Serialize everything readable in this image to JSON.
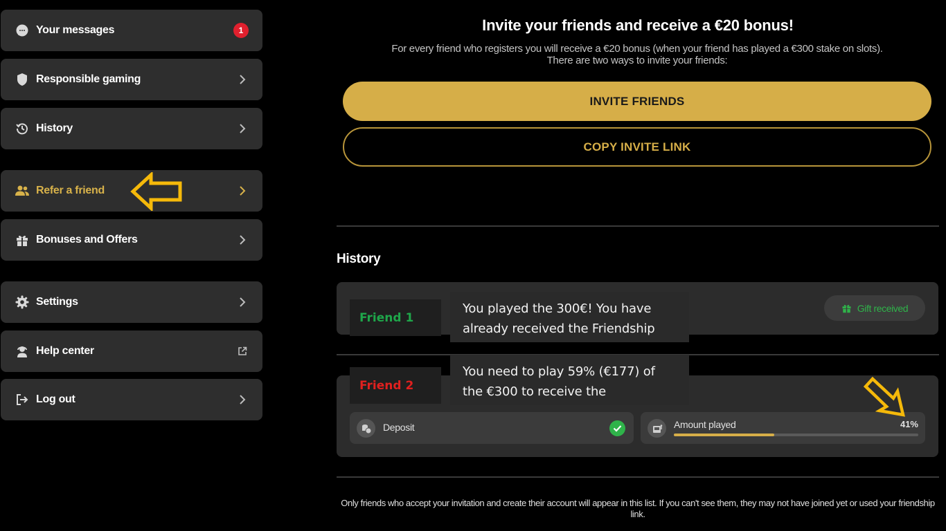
{
  "sidebar": {
    "items": [
      {
        "label": "Your messages",
        "badge": "1"
      },
      {
        "label": "Responsible gaming"
      },
      {
        "label": "History"
      },
      {
        "label": "Refer a friend"
      },
      {
        "label": "Bonuses and Offers"
      },
      {
        "label": "Settings"
      },
      {
        "label": "Help center"
      },
      {
        "label": "Log out"
      }
    ]
  },
  "main": {
    "title": "Invite your friends and receive a €20 bonus!",
    "subtitle": "For every friend who registers you will receive a €20 bonus (when your friend has played a €300 stake on slots). There are two ways to invite your friends:",
    "invite_button": "INVITE FRIENDS",
    "copy_button": "COPY INVITE LINK",
    "history_title": "History",
    "friend1": {
      "name": "Friend 1",
      "note": "You played the 300€! You have already received the Friendship",
      "status": "Gift received"
    },
    "friend2": {
      "name": "Friend 2",
      "note": "You need to play 59% (€177) of the €300 to receive the",
      "deposit_label": "Deposit",
      "amount_label": "Amount played",
      "progress_text": "41%",
      "progress": 0.41
    },
    "footer": "Only friends who accept your invitation and create their account will appear in this list. If you can't see them, they may not have joined yet or used your friendship link."
  },
  "colors": {
    "accent": "#d6ae48",
    "badge": "#e0202e",
    "success": "#2fb34a",
    "friend1": "#1fa64a",
    "friend2": "#e0201f"
  }
}
